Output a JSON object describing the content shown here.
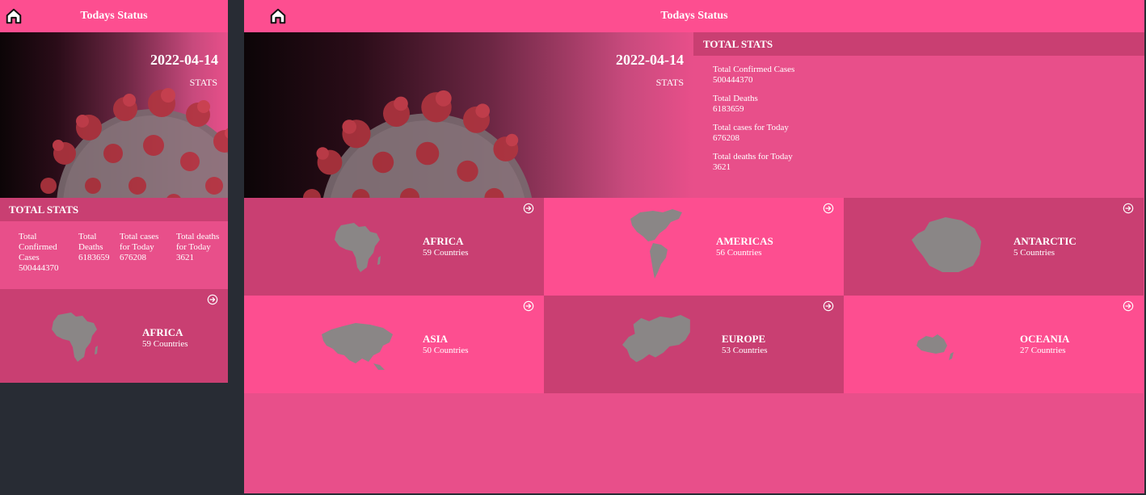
{
  "header": {
    "title": "Todays Status"
  },
  "hero": {
    "date": "2022-04-14",
    "subtitle": "STATS"
  },
  "total_stats": {
    "heading": "TOTAL STATS",
    "items": [
      {
        "label": "Total Confirmed Cases",
        "value": "500444370"
      },
      {
        "label": "Total Deaths",
        "value": "6183659"
      },
      {
        "label": "Total cases for Today",
        "value": "676208"
      },
      {
        "label": "Total deaths for Today",
        "value": "3621"
      }
    ]
  },
  "continents": [
    {
      "name": "AFRICA",
      "countries": "59 Countries"
    },
    {
      "name": "AMERICAS",
      "countries": "56 Countries"
    },
    {
      "name": "ANTARCTIC",
      "countries": "5 Countries"
    },
    {
      "name": "ASIA",
      "countries": "50 Countries"
    },
    {
      "name": "EUROPE",
      "countries": "53 Countries"
    },
    {
      "name": "OCEANIA",
      "countries": "27 Countries"
    }
  ],
  "colors": {
    "bar": "#fd4e90",
    "card_light": "#fd4e90",
    "card_dark": "#c93f72",
    "panel": "#e84f8a",
    "background": "#282c34",
    "map": "#8a8686"
  },
  "icons": {
    "home": "home-icon",
    "open": "arrow-circle-right-icon"
  }
}
